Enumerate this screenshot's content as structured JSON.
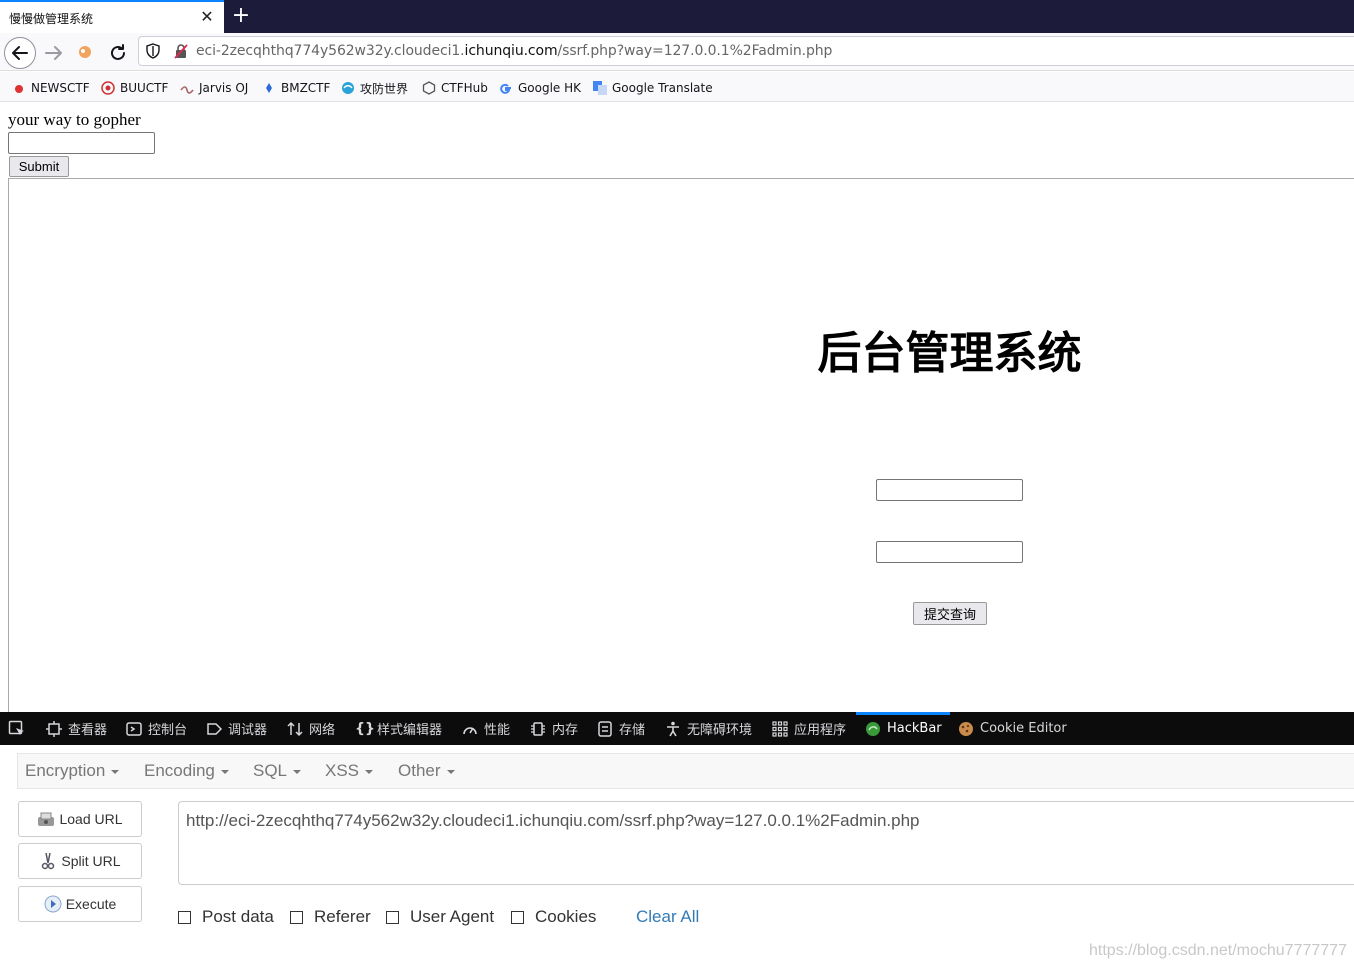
{
  "browser": {
    "tab_title": "慢慢做管理系统",
    "tab_close": "✕",
    "new_tab": "+",
    "url_prefix": "eci-2zecqhthq774y562w32y.cloudeci1.",
    "url_host": "ichunqiu.com",
    "url_path": "/ssrf.php?way=127.0.0.1%2Fadmin.php"
  },
  "bookmarks": [
    {
      "label": "NEWSCTF",
      "icon": "newsctf-icon",
      "color": "#d33"
    },
    {
      "label": "BUUCTF",
      "icon": "buuctf-icon",
      "color": "#c33"
    },
    {
      "label": "Jarvis OJ",
      "icon": "jarvis-icon",
      "color": "#a66"
    },
    {
      "label": "BMZCTF",
      "icon": "bmzctf-icon",
      "color": "#2a6bd6"
    },
    {
      "label": "攻防世界",
      "icon": "gongfang-icon",
      "color": "#29a3d8"
    },
    {
      "label": "CTFHub",
      "icon": "ctfhub-icon",
      "color": "#555"
    },
    {
      "label": "Google HK",
      "icon": "google-icon",
      "color": "#4285f4"
    },
    {
      "label": "Google Translate",
      "icon": "translate-icon",
      "color": "#4285f4"
    }
  ],
  "page": {
    "heading": "your way to gopher",
    "input_value": "",
    "submit_label": "Submit",
    "admin_title": "后台管理系统",
    "admin_submit_label": "提交查询"
  },
  "devtools": {
    "tabs": [
      {
        "label": "查看器",
        "icon": "inspector-icon"
      },
      {
        "label": "控制台",
        "icon": "console-icon"
      },
      {
        "label": "调试器",
        "icon": "debugger-icon"
      },
      {
        "label": "网络",
        "icon": "network-icon"
      },
      {
        "label": "样式编辑器",
        "icon": "style-editor-icon"
      },
      {
        "label": "性能",
        "icon": "performance-icon"
      },
      {
        "label": "内存",
        "icon": "memory-icon"
      },
      {
        "label": "存储",
        "icon": "storage-icon"
      },
      {
        "label": "无障碍环境",
        "icon": "accessibility-icon"
      },
      {
        "label": "应用程序",
        "icon": "application-icon"
      },
      {
        "label": "HackBar",
        "icon": "hackbar-icon"
      },
      {
        "label": "Cookie Editor",
        "icon": "cookie-icon"
      }
    ],
    "active_tab": "HackBar",
    "accent_color": "#0a84ff"
  },
  "hackbar": {
    "menus": [
      "Encryption",
      "Encoding",
      "SQL",
      "XSS",
      "Other"
    ],
    "buttons": {
      "load": "Load URL",
      "split": "Split URL",
      "execute": "Execute"
    },
    "url_value": "http://eci-2zecqhthq774y562w32y.cloudeci1.ichunqiu.com/ssrf.php?way=127.0.0.1%2Fadmin.php",
    "checkboxes": [
      "Post data",
      "Referer",
      "User Agent",
      "Cookies"
    ],
    "clear_all": "Clear All"
  },
  "watermark": "https://blog.csdn.net/mochu7777777"
}
